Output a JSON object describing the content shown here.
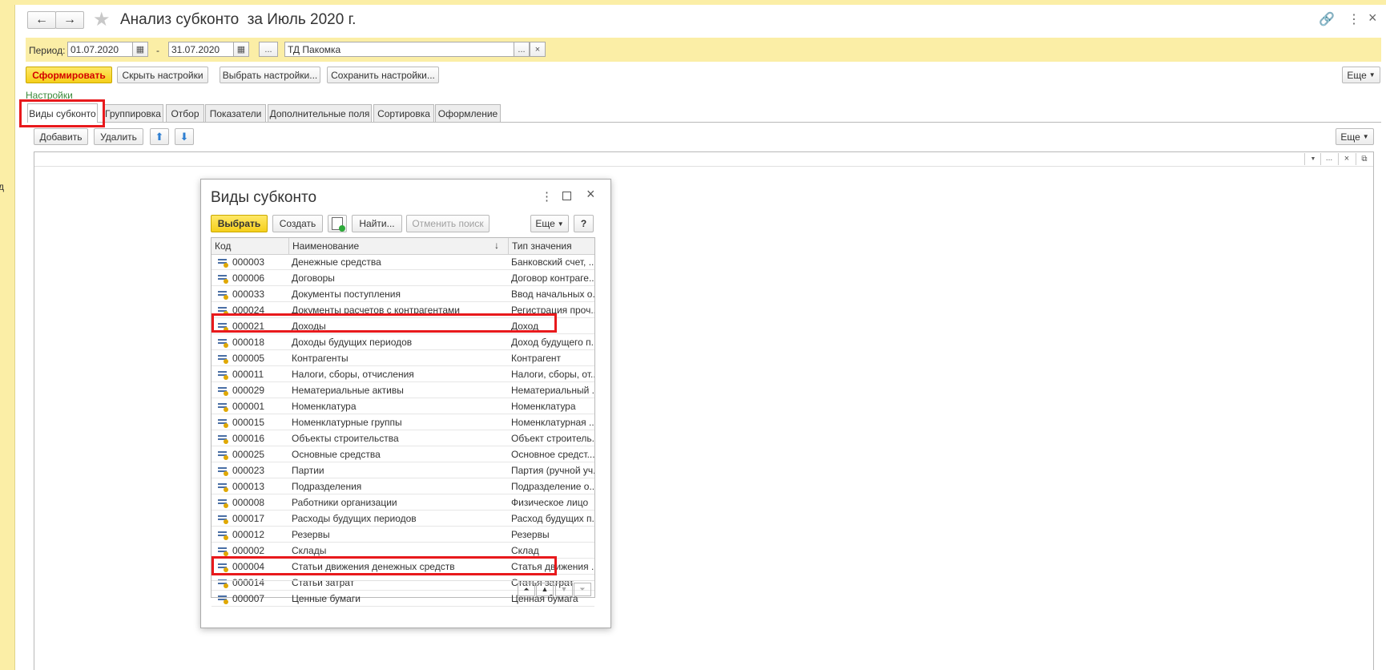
{
  "header": {
    "title": "Анализ субконто  за Июль 2020 г.",
    "back_label": "←",
    "forward_label": "→"
  },
  "period": {
    "label": "Период:",
    "date_from": "01.07.2020",
    "separator": "-",
    "date_to": "31.07.2020",
    "dots_label": "...",
    "organization": "ТД Пакомка",
    "clear_label": "×"
  },
  "toolbar": {
    "generate_label": "Сформировать",
    "hide_settings_label": "Скрыть настройки",
    "choose_settings_label": "Выбрать настройки...",
    "save_settings_label": "Сохранить настройки...",
    "more_label": "Еще"
  },
  "settings_link": "Настройки",
  "tabs": [
    {
      "label": "Виды субконто"
    },
    {
      "label": "Группировка"
    },
    {
      "label": "Отбор"
    },
    {
      "label": "Показатели"
    },
    {
      "label": "Дополнительные поля"
    },
    {
      "label": "Сортировка"
    },
    {
      "label": "Оформление"
    }
  ],
  "tab_toolbar": {
    "add_label": "Добавить",
    "delete_label": "Удалить",
    "more_label": "Еще"
  },
  "dialog": {
    "title": "Виды субконто",
    "select_label": "Выбрать",
    "create_label": "Создать",
    "find_label": "Найти...",
    "cancel_search_label": "Отменить поиск",
    "more_label": "Еще",
    "help_label": "?",
    "columns": {
      "code": "Код",
      "name": "Наименование",
      "type": "Тип значения"
    },
    "rows": [
      {
        "code": "000003",
        "name": "Денежные средства",
        "type": "Банковский счет, ..."
      },
      {
        "code": "000006",
        "name": "Договоры",
        "type": "Договор контраге..."
      },
      {
        "code": "000033",
        "name": "Документы поступления",
        "type": "Ввод начальных о..."
      },
      {
        "code": "000024",
        "name": "Документы расчетов с контрагентами",
        "type": "Регистрация проч..."
      },
      {
        "code": "000021",
        "name": "Доходы",
        "type": "Доход"
      },
      {
        "code": "000018",
        "name": "Доходы будущих периодов",
        "type": "Доход будущего п..."
      },
      {
        "code": "000005",
        "name": "Контрагенты",
        "type": "Контрагент"
      },
      {
        "code": "000011",
        "name": "Налоги, сборы, отчисления",
        "type": "Налоги, сборы, от..."
      },
      {
        "code": "000029",
        "name": "Нематериальные активы",
        "type": "Нематериальный ..."
      },
      {
        "code": "000001",
        "name": "Номенклатура",
        "type": "Номенклатура"
      },
      {
        "code": "000015",
        "name": "Номенклатурные группы",
        "type": "Номенклатурная ..."
      },
      {
        "code": "000016",
        "name": "Объекты строительства",
        "type": "Объект строитель..."
      },
      {
        "code": "000025",
        "name": "Основные средства",
        "type": "Основное средст..."
      },
      {
        "code": "000023",
        "name": "Партии",
        "type": "Партия (ручной уч..."
      },
      {
        "code": "000013",
        "name": "Подразделения",
        "type": "Подразделение о..."
      },
      {
        "code": "000008",
        "name": "Работники организации",
        "type": "Физическое лицо"
      },
      {
        "code": "000017",
        "name": "Расходы будущих периодов",
        "type": "Расход будущих п..."
      },
      {
        "code": "000012",
        "name": "Резервы",
        "type": "Резервы"
      },
      {
        "code": "000002",
        "name": "Склады",
        "type": "Склад"
      },
      {
        "code": "000004",
        "name": "Статьи движения денежных средств",
        "type": "Статья движения ..."
      },
      {
        "code": "000014",
        "name": "Статьи затрат",
        "type": "Статья затрат"
      },
      {
        "code": "000007",
        "name": "Ценные бумаги",
        "type": "Ценная бумага"
      }
    ]
  },
  "colors": {
    "accent_yellow": "#f5cf1b",
    "highlight_red": "#e8191c",
    "link_green": "#3a8a3a"
  }
}
